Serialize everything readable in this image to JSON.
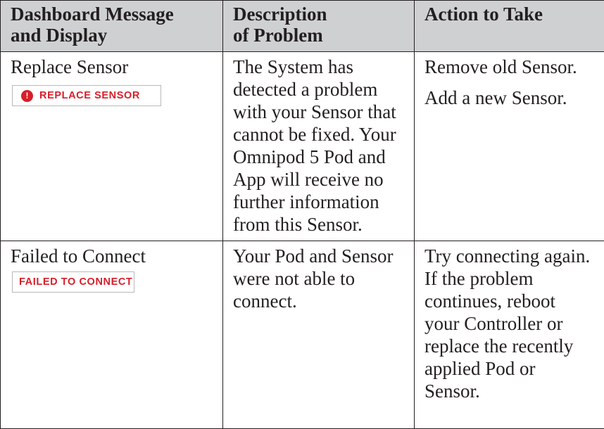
{
  "headers": [
    "Dashboard Message and Display",
    "Description of Problem",
    "Action to Take"
  ],
  "header_lines": [
    [
      "Dashboard Message",
      "and Display"
    ],
    [
      "Description",
      "of Problem"
    ],
    [
      "Action to Take"
    ]
  ],
  "rows": [
    {
      "message": "Replace Sensor",
      "badge": {
        "icon": "alert-exclamation-icon",
        "icon_glyph": "!",
        "text": "REPLACE SENSOR"
      },
      "description": "The System has detected a problem with your Sensor that cannot be fixed. Your Omnipod 5 Pod and App will receive no further information from this Sensor.",
      "actions": [
        "Remove old Sensor.",
        "Add a new Sensor."
      ]
    },
    {
      "message": "Failed to Connect",
      "badge": {
        "text": "FAILED TO CONNECT"
      },
      "description": "Your Pod and Sensor were not able to connect.",
      "actions": [
        "Try connecting again. If the problem continues, reboot your Controller or replace the recently applied Pod or Sensor."
      ]
    }
  ],
  "colors": {
    "header_bg": "#cfd0d2",
    "border": "#231f20",
    "alert_red": "#d81e2a",
    "text": "#231f20"
  }
}
